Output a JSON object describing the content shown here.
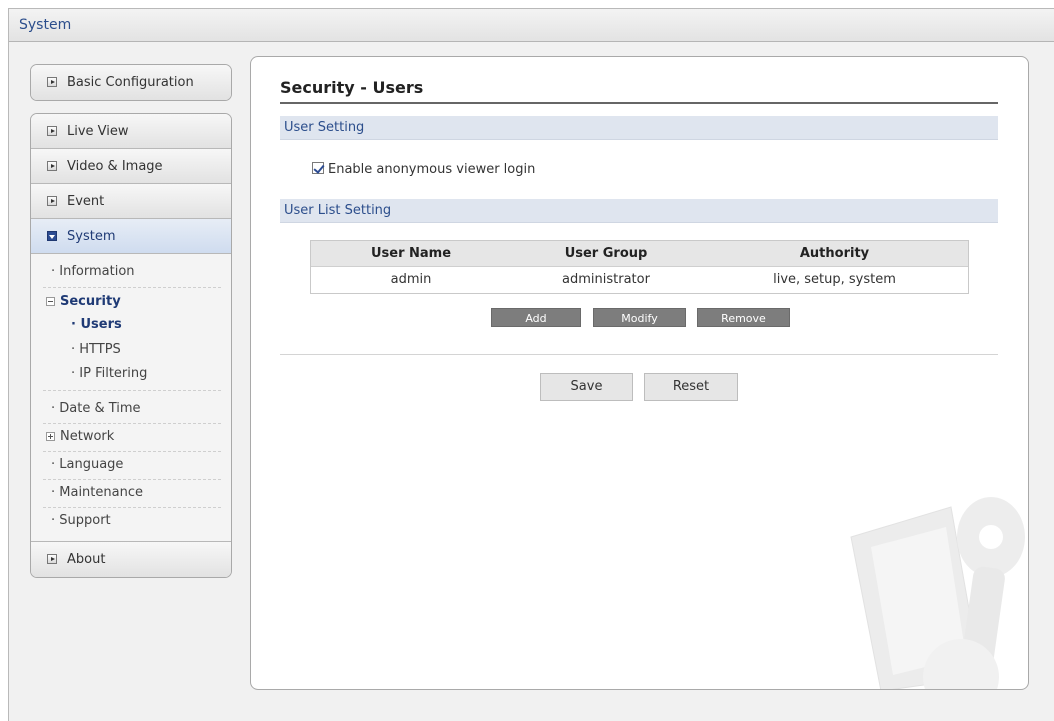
{
  "window": {
    "title": "System"
  },
  "sidebar": {
    "basic": "Basic Configuration",
    "headers": {
      "live_view": "Live View",
      "video_image": "Video & Image",
      "event": "Event",
      "system": "System",
      "about": "About"
    },
    "system_items": {
      "information": "Information",
      "security": "Security",
      "users": "Users",
      "https": "HTTPS",
      "ip_filtering": "IP Filtering",
      "date_time": "Date & Time",
      "network": "Network",
      "language": "Language",
      "maintenance": "Maintenance",
      "support": "Support"
    }
  },
  "main": {
    "title": "Security - Users",
    "user_setting": {
      "heading": "User Setting",
      "anonymous_label": "Enable anonymous viewer login",
      "anonymous_checked": true
    },
    "user_list": {
      "heading": "User List Setting",
      "columns": [
        "User Name",
        "User Group",
        "Authority"
      ],
      "rows": [
        [
          "admin",
          "administrator",
          "live, setup, system"
        ]
      ],
      "buttons": {
        "add": "Add",
        "modify": "Modify",
        "remove": "Remove"
      }
    },
    "actions": {
      "save": "Save",
      "reset": "Reset"
    }
  }
}
